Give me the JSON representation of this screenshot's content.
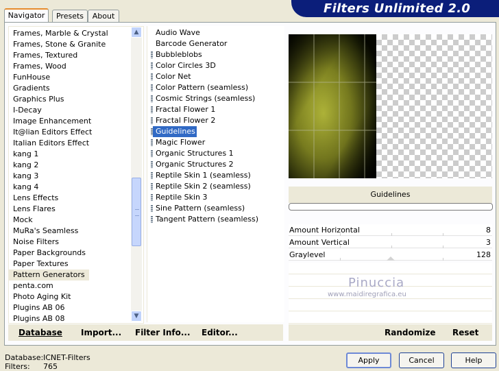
{
  "tabs": [
    {
      "label": "Navigator",
      "active": true
    },
    {
      "label": "Presets",
      "active": false
    },
    {
      "label": "About",
      "active": false
    }
  ],
  "header": {
    "title": "Filters Unlimited 2.0"
  },
  "categories": {
    "items": [
      "Frames, Marble & Crystal",
      "Frames, Stone & Granite",
      "Frames, Textured",
      "Frames, Wood",
      "FunHouse",
      "Gradients",
      "Graphics Plus",
      "I-Decay",
      "Image Enhancement",
      "It@lian Editors Effect",
      "Italian Editors Effect",
      "kang 1",
      "kang 2",
      "kang 3",
      "kang 4",
      "Lens Effects",
      "Lens Flares",
      "Mock",
      "MuRa's Seamless",
      "Noise Filters",
      "Paper Backgrounds",
      "Paper Textures",
      "Pattern Generators",
      "penta.com",
      "Photo Aging Kit",
      "Plugins AB 06",
      "Plugins AB 08"
    ],
    "selected": "Pattern Generators"
  },
  "filters": {
    "items": [
      {
        "label": "Audio Wave",
        "marked": false
      },
      {
        "label": "Barcode Generator",
        "marked": false
      },
      {
        "label": "Bubbleblobs",
        "marked": true
      },
      {
        "label": "Color Circles 3D",
        "marked": true
      },
      {
        "label": "Color Net",
        "marked": true
      },
      {
        "label": "Color Pattern (seamless)",
        "marked": true
      },
      {
        "label": "Cosmic Strings (seamless)",
        "marked": true
      },
      {
        "label": "Fractal Flower 1",
        "marked": true
      },
      {
        "label": "Fractal Flower 2",
        "marked": true
      },
      {
        "label": "Guidelines",
        "marked": true
      },
      {
        "label": "Magic Flower",
        "marked": true
      },
      {
        "label": "Organic Structures 1",
        "marked": true
      },
      {
        "label": "Organic Structures 2",
        "marked": true
      },
      {
        "label": "Reptile Skin 1 (seamless)",
        "marked": true
      },
      {
        "label": "Reptile Skin 2 (seamless)",
        "marked": true
      },
      {
        "label": "Reptile Skin 3",
        "marked": true
      },
      {
        "label": "Sine Pattern (seamless)",
        "marked": true
      },
      {
        "label": "Tangent Pattern (seamless)",
        "marked": true
      }
    ],
    "selected": "Guidelines"
  },
  "preview": {
    "filter_name": "Guidelines",
    "progress": 0
  },
  "params": [
    {
      "name": "Amount Horizontal",
      "value": "8",
      "level": 0.03
    },
    {
      "name": "Amount Vertical",
      "value": "3",
      "level": 0.01
    },
    {
      "name": "Graylevel",
      "value": "128",
      "level": 0.5
    }
  ],
  "watermark": {
    "line1": "Pinuccia",
    "line2": "www.maidiregrafica.eu"
  },
  "bottom_bar": {
    "database": "Database",
    "import": "Import...",
    "filter_info": "Filter Info...",
    "editor": "Editor...",
    "randomize": "Randomize",
    "reset": "Reset"
  },
  "status": {
    "database_label": "Database:",
    "database_value": "ICNET-Filters",
    "filters_label": "Filters:",
    "filters_value": "765"
  },
  "buttons": {
    "apply": "Apply",
    "cancel": "Cancel",
    "help": "Help"
  },
  "colors": {
    "header_bg": "#0b1e7a",
    "selection": "#316ac5",
    "preview_accent": "#9aa020"
  }
}
